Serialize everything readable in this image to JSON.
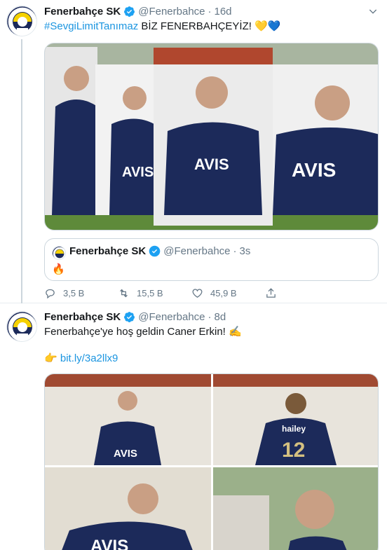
{
  "tweet1": {
    "name": "Fenerbahçe SK",
    "handle": "@Fenerbahce",
    "separator": "·",
    "time": "16d",
    "hashtag": "#SevgiLimitTanımaz",
    "text": "BİZ FENERBAHÇEYİZ!",
    "emoji": "💛💙",
    "media_shirt_sponsor": "AVIS",
    "quote": {
      "name": "Fenerbahçe SK",
      "handle": "@Fenerbahce",
      "separator": "·",
      "time": "3s",
      "text": "🔥"
    },
    "actions": {
      "reply": "3,5 B",
      "retweet": "15,5 B",
      "like": "45,9 B"
    }
  },
  "tweet2": {
    "name": "Fenerbahçe SK",
    "handle": "@Fenerbahce",
    "separator": "·",
    "time": "8d",
    "text": "Fenerbahçe'ye hoş geldin Caner Erkin!",
    "text_emoji": "✍️",
    "link_emoji": "👉",
    "link": "bit.ly/3a2llx9",
    "shirt_number": "12",
    "shirt_name": "hailey"
  },
  "colors": {
    "accent": "#1b95e0",
    "navy": "#1c2a5a",
    "yellow": "#f5d100",
    "muted": "#657786"
  }
}
